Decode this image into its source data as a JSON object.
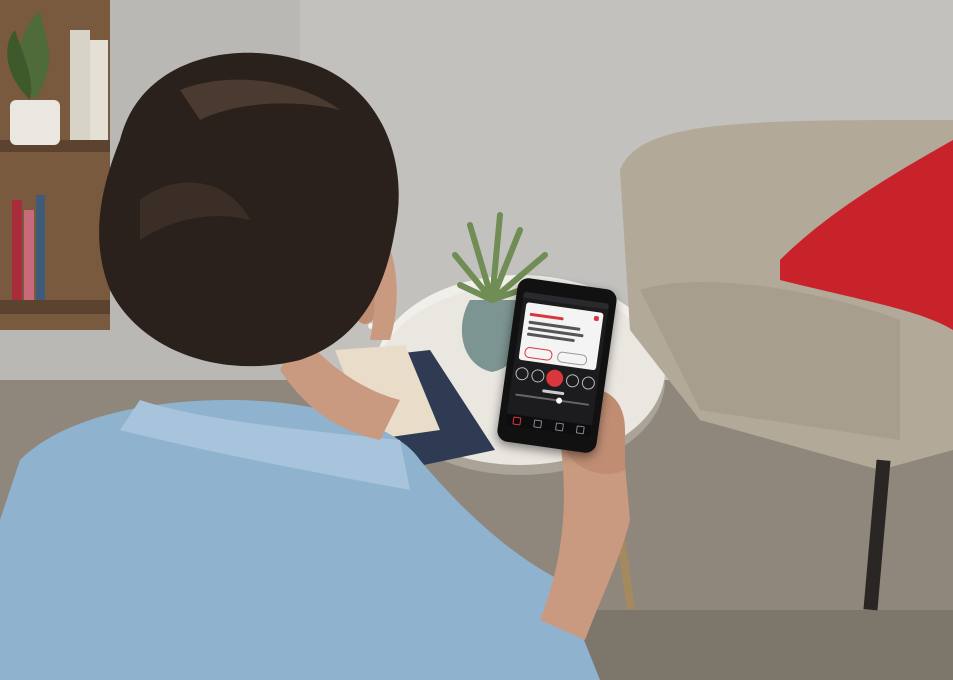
{
  "scene": {
    "description_tag": "woman-using-hearing-aid-app",
    "colors": {
      "wall": "#b9b8b5",
      "floor": "#8a8175",
      "armchair": "#b3a999",
      "pillow": "#c8222b",
      "shirt": "#8fb2cf",
      "hair": "#2b211c",
      "skin": "#c99a80",
      "table": "#f1efea",
      "phone": "#111111",
      "app_accent": "#d9363e"
    }
  },
  "phone_app": {
    "icons": [
      "close-icon",
      "play-icon",
      "volume-icon",
      "home-icon",
      "settings-icon"
    ]
  }
}
